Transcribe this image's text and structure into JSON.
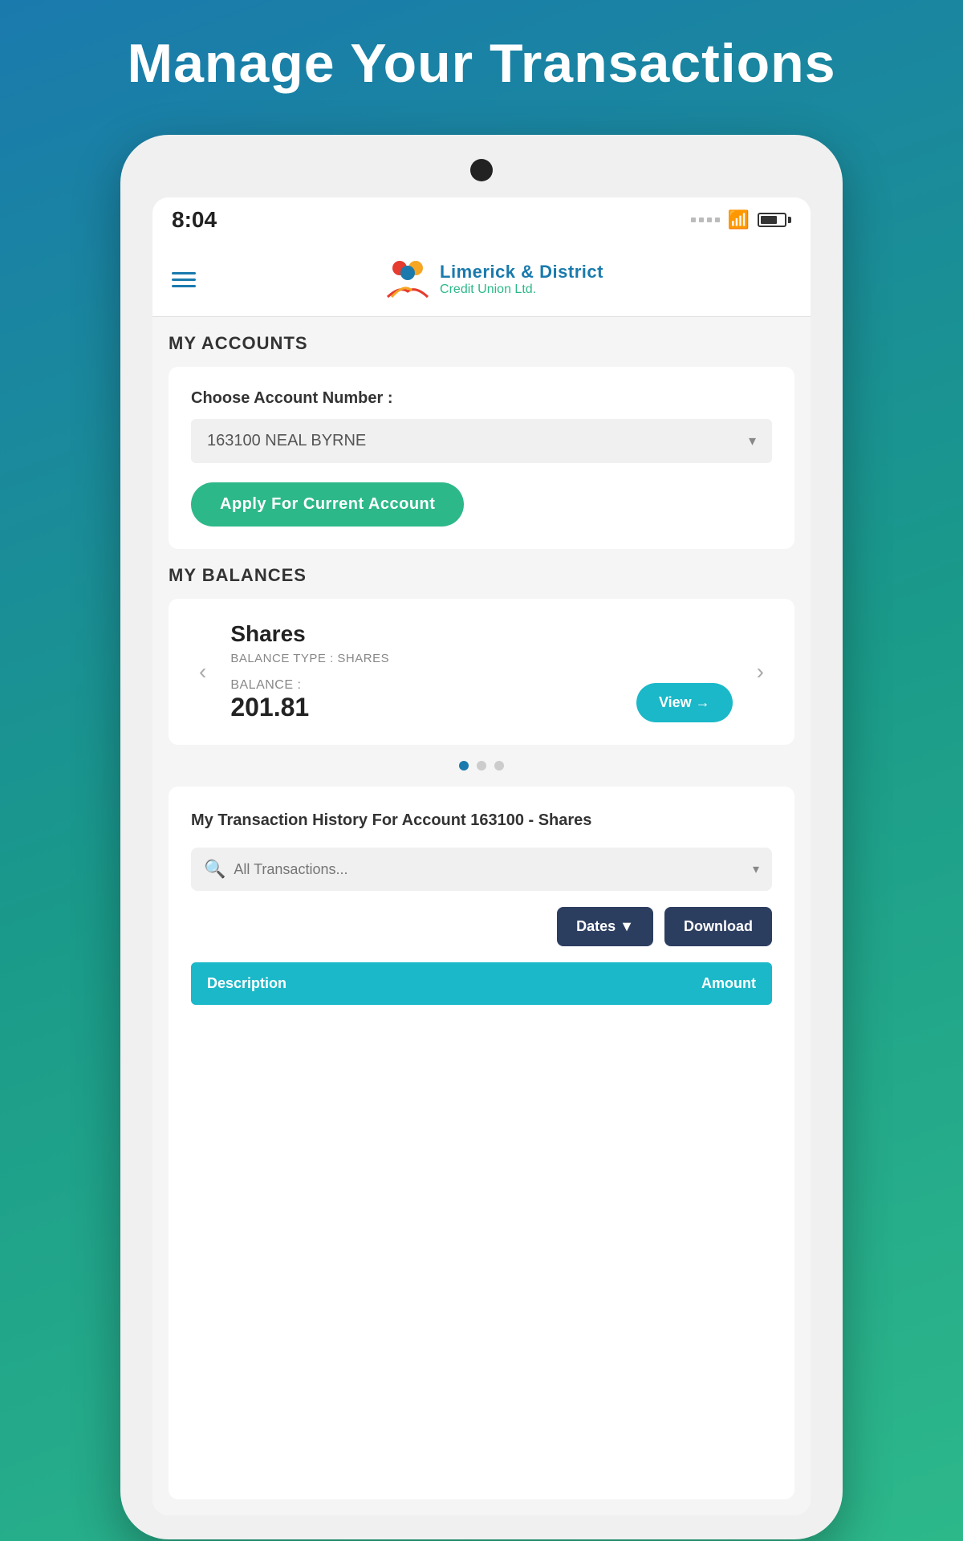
{
  "page": {
    "title": "Manage Your Transactions"
  },
  "status_bar": {
    "time": "8:04"
  },
  "nav": {
    "logo_text_main": "Limerick & District",
    "logo_text_sub": "Credit Union Ltd."
  },
  "my_accounts": {
    "section_title": "MY ACCOUNTS",
    "account_label": "Choose Account Number :",
    "account_value": "163100 NEAL BYRNE",
    "apply_button": "Apply For Current Account"
  },
  "my_balances": {
    "section_title": "MY BALANCES",
    "balance_title": "Shares",
    "balance_type": "BALANCE TYPE : SHARES",
    "balance_label": "BALANCE :",
    "balance_amount": "201.81",
    "view_button": "View →",
    "dots": [
      {
        "active": true
      },
      {
        "active": false
      },
      {
        "active": false
      }
    ]
  },
  "transaction_history": {
    "title": "My Transaction History For Account 163100 - Shares",
    "search_placeholder": "All Transactions...",
    "dates_button": "Dates ▼",
    "download_button": "Download",
    "table_col1": "Description",
    "table_col2": "Amount"
  }
}
